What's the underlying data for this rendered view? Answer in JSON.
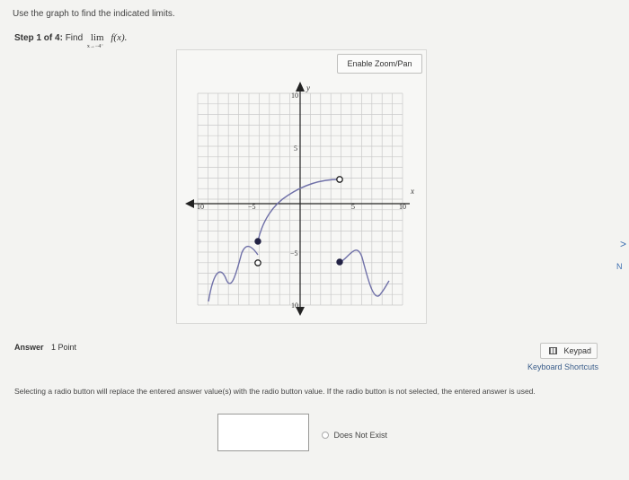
{
  "instructions": "Use the graph to find the indicated limits.",
  "step": {
    "label": "Step 1 of 4:",
    "find": "Find",
    "lim": "lim",
    "lim_sub": "x→−4⁻",
    "fx": "f(x)."
  },
  "graph": {
    "zoom_label": "Enable Zoom/Pan",
    "x_axis_label": "x",
    "y_axis_label": "y",
    "tick_labels": {
      "x_neg10": "10",
      "x_neg5": "−5",
      "x_pos5": "5",
      "x_pos10": "10",
      "y_pos10": "10",
      "y_pos5": "5",
      "y_neg5": "−5",
      "y_neg10": "10"
    }
  },
  "answer": {
    "label": "Answer",
    "points": "1 Point",
    "keypad": "Keypad",
    "shortcuts": "Keyboard Shortcuts",
    "note": "Selecting a radio button will replace the entered answer value(s) with the radio button value. If the radio button is not selected, the entered answer is used.",
    "dne": "Does Not Exist"
  },
  "edge": {
    "arrow": ">",
    "text": "N"
  },
  "colors": {
    "curve": "#6f70a8",
    "axis": "#222222",
    "grid": "#c9c9c9",
    "link": "#3a5d8a"
  }
}
